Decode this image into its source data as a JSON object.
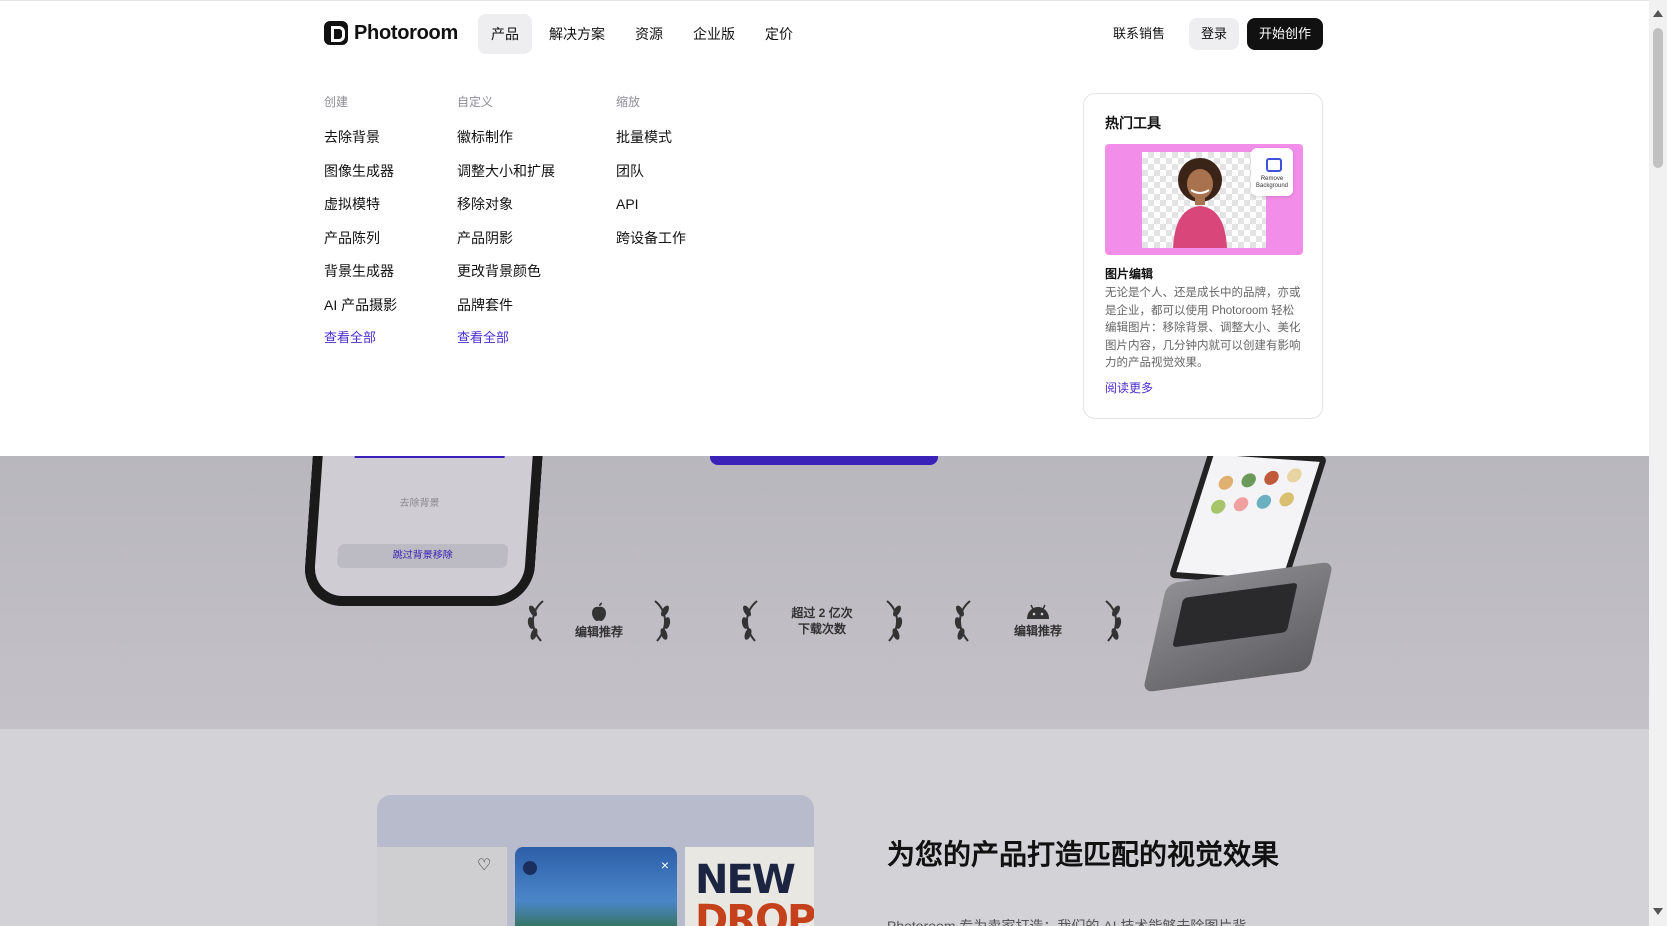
{
  "header": {
    "logo_text": "Photoroom",
    "nav": [
      {
        "label": "产品",
        "active": true
      },
      {
        "label": "解决方案"
      },
      {
        "label": "资源"
      },
      {
        "label": "企业版"
      },
      {
        "label": "定价"
      }
    ],
    "contact_label": "联系销售",
    "login_label": "登录",
    "start_label": "开始创作"
  },
  "menu": {
    "columns": [
      {
        "heading": "创建",
        "items": [
          "去除背景",
          "图像生成器",
          "虚拟模特",
          "产品陈列",
          "背景生成器",
          "AI 产品摄影"
        ],
        "more": "查看全部"
      },
      {
        "heading": "自定义",
        "items": [
          "徽标制作",
          "调整大小和扩展",
          "移除对象",
          "产品阴影",
          "更改背景颜色",
          "品牌套件"
        ],
        "more": "查看全部"
      },
      {
        "heading": "缩放",
        "items": [
          "批量模式",
          "团队",
          "API",
          "跨设备工作"
        ],
        "more": ""
      }
    ],
    "featured": {
      "title": "热门工具",
      "badge_text": "Remove Background",
      "subtitle": "图片编辑",
      "description": "无论是个人、还是成长中的品牌，亦或是企业，都可以使用 Photoroom 轻松编辑图片：移除背景、调整大小、美化图片内容，几分钟内就可以创建有影响力的产品视觉效果。",
      "link": "阅读更多"
    }
  },
  "hero": {
    "phone_loading": "去除背景",
    "phone_button": "跳过背景移除",
    "awards": [
      {
        "icon": "apple-icon",
        "text": "编辑推荐"
      },
      {
        "icon": "",
        "line1": "超过 2 亿次",
        "line2": "下载次数"
      },
      {
        "icon": "android-icon",
        "text": "编辑推荐"
      }
    ]
  },
  "lower": {
    "title": "为您的产品打造匹配的视觉效果",
    "subtitle": "Photoroom 专为卖家打造：我们的 AI 技术能够去除图片背",
    "card_poster_line1": "NEW",
    "card_poster_line2": "DROP"
  },
  "colors": {
    "accent": "#4a2cd0",
    "primary_button": "#111111",
    "featured_bg": "#f28ee9"
  }
}
